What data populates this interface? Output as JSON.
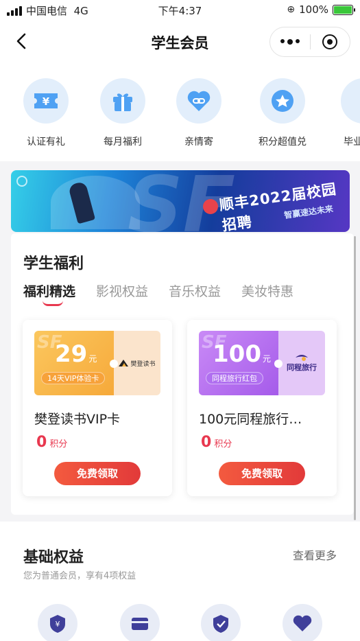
{
  "status_bar": {
    "carrier": "中国电信",
    "network": "4G",
    "time": "下午4:37",
    "battery": "100%"
  },
  "nav": {
    "title": "学生会员"
  },
  "quick_items": [
    {
      "label": "认证有礼",
      "icon": "coupon-yen-icon"
    },
    {
      "label": "每月福利",
      "icon": "gift-icon"
    },
    {
      "label": "亲情寄",
      "icon": "heart-link-icon"
    },
    {
      "label": "积分超值兑",
      "icon": "star-icon"
    },
    {
      "label": "毕业",
      "icon": "gift-icon"
    }
  ],
  "banner": {
    "title": "顺丰2022届校园招聘",
    "subtitle": "智赢速达未来"
  },
  "welfare": {
    "title": "学生福利",
    "tabs": [
      "福利精选",
      "影视权益",
      "音乐权益",
      "美妆特惠"
    ],
    "active_tab": 0,
    "cards": [
      {
        "amount": "29",
        "unit": "元",
        "coupon_label": "14天VIP体验卡",
        "brand": "樊登读书",
        "name": "樊登读书VIP卡",
        "points": "0",
        "points_unit": "积分",
        "button": "免费领取",
        "accent": "#f8b34a",
        "brand_bg": "#fbe4cc"
      },
      {
        "amount": "100",
        "unit": "元",
        "coupon_label": "同程旅行红包",
        "brand": "同程旅行",
        "name": "100元同程旅行…",
        "points": "0",
        "points_unit": "积分",
        "button": "免费领取",
        "accent": "#b368f0",
        "brand_bg": "#e4c8f8"
      }
    ]
  },
  "basic": {
    "title": "基础权益",
    "more": "查看更多",
    "subtitle": "您为普通会员，享有4项权益"
  },
  "colors": {
    "primary_red": "#e8384f",
    "icon_blue": "#4fa1f3"
  }
}
